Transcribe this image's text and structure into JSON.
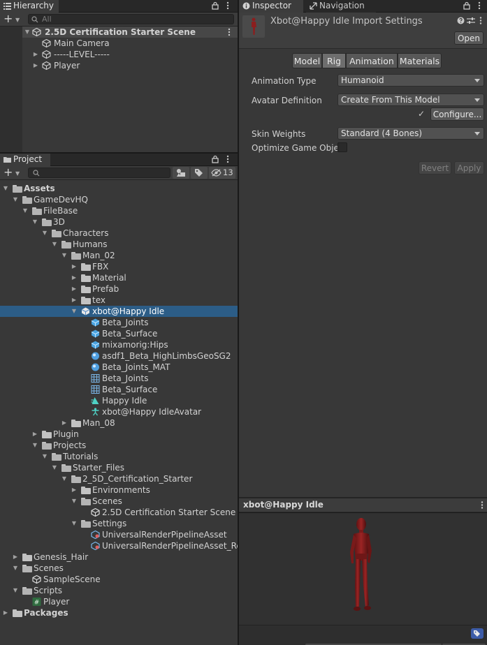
{
  "hierarchy": {
    "tab_label": "Hierarchy",
    "search_placeholder": "All",
    "items": [
      {
        "label": "2.5D Certification Starter Scene"
      },
      {
        "label": "Main Camera"
      },
      {
        "label": "-----LEVEL-----"
      },
      {
        "label": "Player"
      }
    ]
  },
  "project": {
    "tab_label": "Project",
    "hidden_count": "13",
    "tree": [
      {
        "label": "Assets"
      },
      {
        "label": "GameDevHQ"
      },
      {
        "label": "FileBase"
      },
      {
        "label": "3D"
      },
      {
        "label": "Characters"
      },
      {
        "label": "Humans"
      },
      {
        "label": "Man_02"
      },
      {
        "label": "FBX"
      },
      {
        "label": "Material"
      },
      {
        "label": "Prefab"
      },
      {
        "label": "tex"
      },
      {
        "label": "xbot@Happy Idle"
      },
      {
        "label": "Beta_Joints"
      },
      {
        "label": "Beta_Surface"
      },
      {
        "label": "mixamorig:Hips"
      },
      {
        "label": "asdf1_Beta_HighLimbsGeoSG2"
      },
      {
        "label": "Beta_Joints_MAT"
      },
      {
        "label": "Beta_Joints"
      },
      {
        "label": "Beta_Surface"
      },
      {
        "label": "Happy Idle"
      },
      {
        "label": "xbot@Happy IdleAvatar"
      },
      {
        "label": "Man_08"
      },
      {
        "label": "Plugin"
      },
      {
        "label": "Projects"
      },
      {
        "label": "Tutorials"
      },
      {
        "label": "Starter_Files"
      },
      {
        "label": "2_5D_Certification_Starter"
      },
      {
        "label": "Environments"
      },
      {
        "label": "Scenes"
      },
      {
        "label": "2.5D Certification Starter Scene"
      },
      {
        "label": "Settings"
      },
      {
        "label": "UniversalRenderPipelineAsset"
      },
      {
        "label": "UniversalRenderPipelineAsset_Rer"
      },
      {
        "label": "Genesis_Hair"
      },
      {
        "label": "Scenes"
      },
      {
        "label": "SampleScene"
      },
      {
        "label": "Scripts"
      },
      {
        "label": "Player"
      },
      {
        "label": "Packages"
      }
    ]
  },
  "inspector": {
    "tab_label": "Inspector",
    "nav_tab_label": "Navigation",
    "title": "Xbot@Happy Idle Import Settings",
    "open_label": "Open",
    "tabs": [
      "Model",
      "Rig",
      "Animation",
      "Materials"
    ],
    "active_tab": "Rig",
    "animation_type_label": "Animation Type",
    "animation_type_value": "Humanoid",
    "avatar_definition_label": "Avatar Definition",
    "avatar_definition_value": "Create From This Model",
    "configure_label": "Configure...",
    "configure_check": "✓",
    "skin_weights_label": "Skin Weights",
    "skin_weights_value": "Standard (4 Bones)",
    "optimize_label": "Optimize Game Objec",
    "optimize_checked": false,
    "revert_label": "Revert",
    "apply_label": "Apply"
  },
  "preview": {
    "title": "xbot@Happy Idle"
  },
  "colors": {
    "selection": "#2c5d87",
    "panel": "#383838",
    "accent_teal": "#4fd1c5",
    "model_red": "#8b1e1e"
  }
}
